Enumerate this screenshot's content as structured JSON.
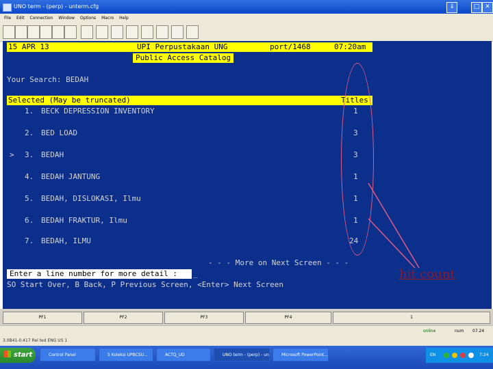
{
  "window": {
    "title": "UNO term - (perp) - unterm.cfg",
    "menu": [
      "File",
      "Edit",
      "Connection",
      "Window",
      "Options",
      "Macro",
      "Help"
    ]
  },
  "terminal": {
    "header_left": "15 APR 13",
    "header_center": "UPI Perpustakaan UNG",
    "header_center2": "Public Access Catalog",
    "header_port": "port/1468",
    "header_time": "07:20am",
    "search_label": "Your Search: BEDAH",
    "table_header_left": "Selected (May be truncated)",
    "table_header_right": "Titles",
    "rows": [
      {
        "marker": " ",
        "num": "1.",
        "text": "BECK DEPRESSION INVENTORY",
        "count": "1"
      },
      {
        "marker": " ",
        "num": "2.",
        "text": "BED LOAD",
        "count": "3"
      },
      {
        "marker": ">",
        "num": "3.",
        "text": "BEDAH",
        "count": "3"
      },
      {
        "marker": " ",
        "num": "4.",
        "text": "BEDAH JANTUNG",
        "count": "1"
      },
      {
        "marker": " ",
        "num": "5.",
        "text": "BEDAH, DISLOKASI, Ilmu",
        "count": "1"
      },
      {
        "marker": " ",
        "num": "6.",
        "text": "BEDAH FRAKTUR, Ilmu",
        "count": "1"
      },
      {
        "marker": " ",
        "num": "7.",
        "text": "BEDAH, ILMU",
        "count": "24"
      }
    ],
    "more_notice": "- - - More on Next Screen - - -",
    "prompt": "Enter a line number for more detail : ",
    "cursor": "_",
    "help_line": "SO Start Over, B Back, P Previous Screen, <Enter> Next Screen"
  },
  "annotation": {
    "label": "hit count",
    "color": "#e05a88"
  },
  "fkeys": [
    "PF1",
    "PF2",
    "PF3",
    "PF4",
    "1"
  ],
  "status": {
    "online": "online",
    "mode": "num",
    "position": "07.24"
  },
  "info_strip": "3.0B41-0.417     Rel ted        ENG  US 1",
  "taskbar": {
    "start_label": "start",
    "tasks": [
      {
        "label": "Control Panel",
        "active": false
      },
      {
        "label": "5 Koleksi UPBCSU...",
        "active": false
      },
      {
        "label": "ACTQ_UD",
        "active": false
      },
      {
        "label": "UNO term - (perp) - un...",
        "active": true
      },
      {
        "label": "Microsoft PowerPoint...",
        "active": false
      }
    ],
    "tray_lang": "EN",
    "clock": "7:24"
  }
}
